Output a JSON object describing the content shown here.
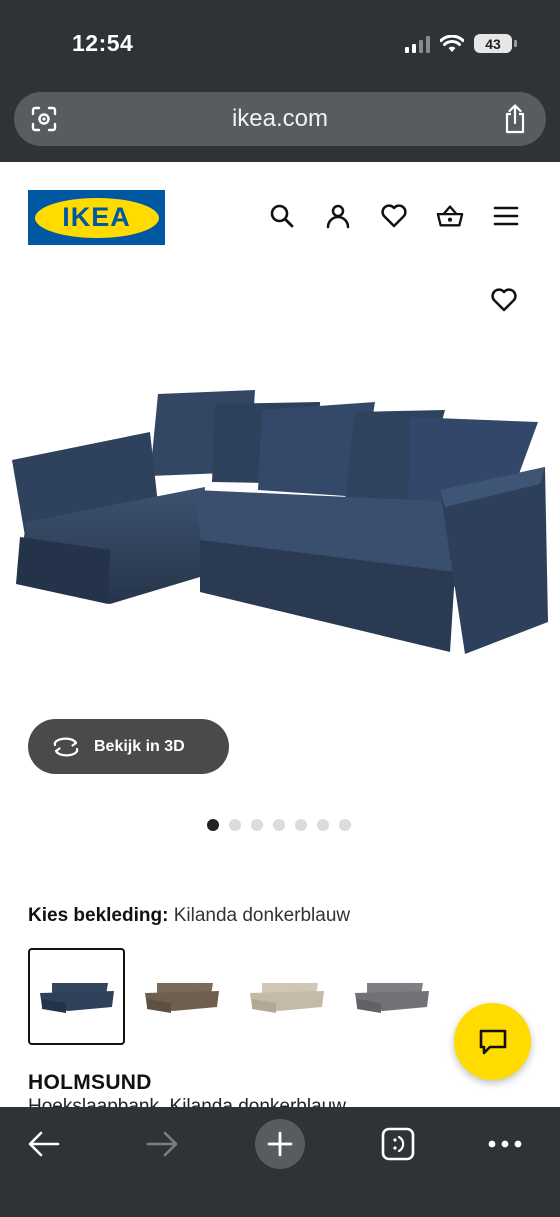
{
  "status_bar": {
    "time": "12:54",
    "battery": "43",
    "icons": [
      "cellular-signal-icon",
      "wifi-icon",
      "battery-icon"
    ]
  },
  "browser": {
    "url": "ikea.com",
    "left_icon": "visual-search-icon",
    "right_icon": "share-icon"
  },
  "header": {
    "logo_text": "IKEA",
    "icons": [
      "search-icon",
      "account-icon",
      "heart-icon",
      "basket-icon",
      "menu-icon"
    ]
  },
  "product_image": {
    "favorite_icon": "heart-icon",
    "view_3d_label": "Bekijk in 3D",
    "carousel_count": 7,
    "carousel_active": 1
  },
  "upholstery": {
    "label": "Kies bekleding:",
    "value": "Kilanda donkerblauw",
    "swatches": [
      {
        "name": "Kilanda donkerblauw",
        "color": "#34465e",
        "selected": true
      },
      {
        "name": "brown",
        "color": "#7a6a58",
        "selected": false
      },
      {
        "name": "beige",
        "color": "#cfc6b5",
        "selected": false
      },
      {
        "name": "grey",
        "color": "#7d7f82",
        "selected": false
      }
    ]
  },
  "product": {
    "name": "HOLMSUND",
    "description": "Hoekslaapbank, Kilanda donkerblauw"
  },
  "chat": {
    "icon": "chat-icon"
  },
  "bottom_bar": {
    "icons": [
      "back-arrow-icon",
      "forward-arrow-icon",
      "new-tab-icon",
      "tabs-icon",
      "more-icon"
    ]
  },
  "colors": {
    "ikea_blue": "#0058a3",
    "ikea_yellow": "#ffdb00",
    "chrome_dark": "#2f3336"
  }
}
